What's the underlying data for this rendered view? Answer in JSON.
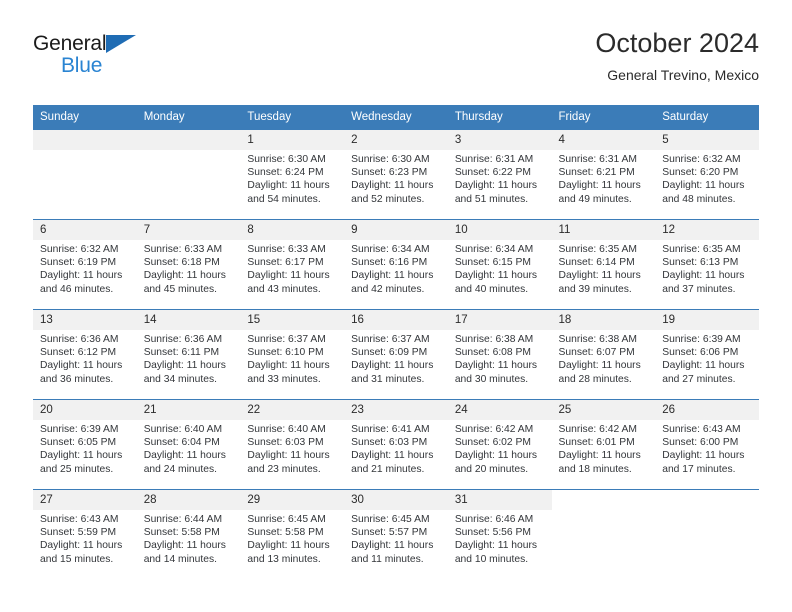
{
  "brand": {
    "word_one": "General",
    "word_two": "Blue",
    "triangle_color": "#1f6cb4"
  },
  "header": {
    "title": "October 2024",
    "subtitle": "General Trevino, Mexico"
  },
  "theme": {
    "header_blue": "#3b7cb8",
    "daynum_band": "#f1f1f1",
    "text": "#2b2b2b",
    "brand_blue": "#2a84d2"
  },
  "weekday_headers": [
    "Sunday",
    "Monday",
    "Tuesday",
    "Wednesday",
    "Thursday",
    "Friday",
    "Saturday"
  ],
  "labels": {
    "sunrise_prefix": "Sunrise:",
    "sunset_prefix": "Sunset:",
    "daylight_prefix": "Daylight:"
  },
  "weeks": [
    [
      {
        "day": "",
        "empty": true
      },
      {
        "day": "",
        "empty": true
      },
      {
        "day": "1",
        "sunrise": "Sunrise: 6:30 AM",
        "sunset": "Sunset: 6:24 PM",
        "daylight_1": "Daylight: 11 hours",
        "daylight_2": "and 54 minutes."
      },
      {
        "day": "2",
        "sunrise": "Sunrise: 6:30 AM",
        "sunset": "Sunset: 6:23 PM",
        "daylight_1": "Daylight: 11 hours",
        "daylight_2": "and 52 minutes."
      },
      {
        "day": "3",
        "sunrise": "Sunrise: 6:31 AM",
        "sunset": "Sunset: 6:22 PM",
        "daylight_1": "Daylight: 11 hours",
        "daylight_2": "and 51 minutes."
      },
      {
        "day": "4",
        "sunrise": "Sunrise: 6:31 AM",
        "sunset": "Sunset: 6:21 PM",
        "daylight_1": "Daylight: 11 hours",
        "daylight_2": "and 49 minutes."
      },
      {
        "day": "5",
        "sunrise": "Sunrise: 6:32 AM",
        "sunset": "Sunset: 6:20 PM",
        "daylight_1": "Daylight: 11 hours",
        "daylight_2": "and 48 minutes."
      }
    ],
    [
      {
        "day": "6",
        "sunrise": "Sunrise: 6:32 AM",
        "sunset": "Sunset: 6:19 PM",
        "daylight_1": "Daylight: 11 hours",
        "daylight_2": "and 46 minutes."
      },
      {
        "day": "7",
        "sunrise": "Sunrise: 6:33 AM",
        "sunset": "Sunset: 6:18 PM",
        "daylight_1": "Daylight: 11 hours",
        "daylight_2": "and 45 minutes."
      },
      {
        "day": "8",
        "sunrise": "Sunrise: 6:33 AM",
        "sunset": "Sunset: 6:17 PM",
        "daylight_1": "Daylight: 11 hours",
        "daylight_2": "and 43 minutes."
      },
      {
        "day": "9",
        "sunrise": "Sunrise: 6:34 AM",
        "sunset": "Sunset: 6:16 PM",
        "daylight_1": "Daylight: 11 hours",
        "daylight_2": "and 42 minutes."
      },
      {
        "day": "10",
        "sunrise": "Sunrise: 6:34 AM",
        "sunset": "Sunset: 6:15 PM",
        "daylight_1": "Daylight: 11 hours",
        "daylight_2": "and 40 minutes."
      },
      {
        "day": "11",
        "sunrise": "Sunrise: 6:35 AM",
        "sunset": "Sunset: 6:14 PM",
        "daylight_1": "Daylight: 11 hours",
        "daylight_2": "and 39 minutes."
      },
      {
        "day": "12",
        "sunrise": "Sunrise: 6:35 AM",
        "sunset": "Sunset: 6:13 PM",
        "daylight_1": "Daylight: 11 hours",
        "daylight_2": "and 37 minutes."
      }
    ],
    [
      {
        "day": "13",
        "sunrise": "Sunrise: 6:36 AM",
        "sunset": "Sunset: 6:12 PM",
        "daylight_1": "Daylight: 11 hours",
        "daylight_2": "and 36 minutes."
      },
      {
        "day": "14",
        "sunrise": "Sunrise: 6:36 AM",
        "sunset": "Sunset: 6:11 PM",
        "daylight_1": "Daylight: 11 hours",
        "daylight_2": "and 34 minutes."
      },
      {
        "day": "15",
        "sunrise": "Sunrise: 6:37 AM",
        "sunset": "Sunset: 6:10 PM",
        "daylight_1": "Daylight: 11 hours",
        "daylight_2": "and 33 minutes."
      },
      {
        "day": "16",
        "sunrise": "Sunrise: 6:37 AM",
        "sunset": "Sunset: 6:09 PM",
        "daylight_1": "Daylight: 11 hours",
        "daylight_2": "and 31 minutes."
      },
      {
        "day": "17",
        "sunrise": "Sunrise: 6:38 AM",
        "sunset": "Sunset: 6:08 PM",
        "daylight_1": "Daylight: 11 hours",
        "daylight_2": "and 30 minutes."
      },
      {
        "day": "18",
        "sunrise": "Sunrise: 6:38 AM",
        "sunset": "Sunset: 6:07 PM",
        "daylight_1": "Daylight: 11 hours",
        "daylight_2": "and 28 minutes."
      },
      {
        "day": "19",
        "sunrise": "Sunrise: 6:39 AM",
        "sunset": "Sunset: 6:06 PM",
        "daylight_1": "Daylight: 11 hours",
        "daylight_2": "and 27 minutes."
      }
    ],
    [
      {
        "day": "20",
        "sunrise": "Sunrise: 6:39 AM",
        "sunset": "Sunset: 6:05 PM",
        "daylight_1": "Daylight: 11 hours",
        "daylight_2": "and 25 minutes."
      },
      {
        "day": "21",
        "sunrise": "Sunrise: 6:40 AM",
        "sunset": "Sunset: 6:04 PM",
        "daylight_1": "Daylight: 11 hours",
        "daylight_2": "and 24 minutes."
      },
      {
        "day": "22",
        "sunrise": "Sunrise: 6:40 AM",
        "sunset": "Sunset: 6:03 PM",
        "daylight_1": "Daylight: 11 hours",
        "daylight_2": "and 23 minutes."
      },
      {
        "day": "23",
        "sunrise": "Sunrise: 6:41 AM",
        "sunset": "Sunset: 6:03 PM",
        "daylight_1": "Daylight: 11 hours",
        "daylight_2": "and 21 minutes."
      },
      {
        "day": "24",
        "sunrise": "Sunrise: 6:42 AM",
        "sunset": "Sunset: 6:02 PM",
        "daylight_1": "Daylight: 11 hours",
        "daylight_2": "and 20 minutes."
      },
      {
        "day": "25",
        "sunrise": "Sunrise: 6:42 AM",
        "sunset": "Sunset: 6:01 PM",
        "daylight_1": "Daylight: 11 hours",
        "daylight_2": "and 18 minutes."
      },
      {
        "day": "26",
        "sunrise": "Sunrise: 6:43 AM",
        "sunset": "Sunset: 6:00 PM",
        "daylight_1": "Daylight: 11 hours",
        "daylight_2": "and 17 minutes."
      }
    ],
    [
      {
        "day": "27",
        "sunrise": "Sunrise: 6:43 AM",
        "sunset": "Sunset: 5:59 PM",
        "daylight_1": "Daylight: 11 hours",
        "daylight_2": "and 15 minutes."
      },
      {
        "day": "28",
        "sunrise": "Sunrise: 6:44 AM",
        "sunset": "Sunset: 5:58 PM",
        "daylight_1": "Daylight: 11 hours",
        "daylight_2": "and 14 minutes."
      },
      {
        "day": "29",
        "sunrise": "Sunrise: 6:45 AM",
        "sunset": "Sunset: 5:58 PM",
        "daylight_1": "Daylight: 11 hours",
        "daylight_2": "and 13 minutes."
      },
      {
        "day": "30",
        "sunrise": "Sunrise: 6:45 AM",
        "sunset": "Sunset: 5:57 PM",
        "daylight_1": "Daylight: 11 hours",
        "daylight_2": "and 11 minutes."
      },
      {
        "day": "31",
        "sunrise": "Sunrise: 6:46 AM",
        "sunset": "Sunset: 5:56 PM",
        "daylight_1": "Daylight: 11 hours",
        "daylight_2": "and 10 minutes."
      },
      {
        "day": "",
        "empty": true,
        "blank": true
      },
      {
        "day": "",
        "empty": true,
        "blank": true
      }
    ]
  ]
}
